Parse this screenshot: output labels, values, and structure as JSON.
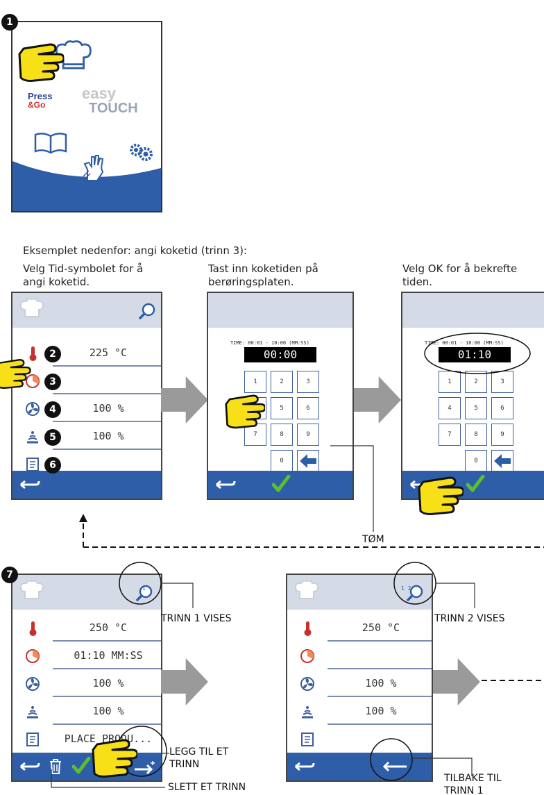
{
  "badges": [
    "1",
    "2",
    "3",
    "4",
    "5",
    "6",
    "7"
  ],
  "home_screen": {
    "press_go_line1": "Press",
    "press_go_line2": "&Go",
    "easy": "easy",
    "touch": "TOUCH"
  },
  "intro_text": "Eksemplet nedenfor: angi koketid (trinn 3):",
  "captions": {
    "step_a": "Velg Tid-symbolet for å angi koketid.",
    "step_b": "Tast inn koketiden på berøringsplaten.",
    "step_c": "Velg OK for å bekrefte tiden."
  },
  "settings_screen": {
    "rows": [
      {
        "icon": "thermometer-icon",
        "value": "225 °C"
      },
      {
        "icon": "timer-icon",
        "value": ""
      },
      {
        "icon": "fan-icon",
        "value": "100 %"
      },
      {
        "icon": "steam-icon",
        "value": "100 %"
      },
      {
        "icon": "notes-icon",
        "value": ""
      }
    ]
  },
  "keypad_screen_1": {
    "header": "TIME: 00:01 - 10:00 (MM:SS)",
    "display": "00:00"
  },
  "keypad_screen_2": {
    "header": "TIME: 00:01 - 10:00 (MM:SS)",
    "display": "01:10"
  },
  "keys": [
    "1",
    "2",
    "3",
    "4",
    "5",
    "6",
    "7",
    "8",
    "9",
    "0"
  ],
  "tom_label": "TØM",
  "step1_screen": {
    "rows": [
      {
        "icon": "thermometer-icon",
        "value": "250 °C"
      },
      {
        "icon": "timer-icon",
        "value": "01:10 MM:SS"
      },
      {
        "icon": "fan-icon",
        "value": "100 %"
      },
      {
        "icon": "steam-icon",
        "value": "100 %"
      },
      {
        "icon": "notes-icon",
        "value": "PLACE PRODU..."
      }
    ],
    "zoom_index": "1"
  },
  "step2_screen": {
    "rows": [
      {
        "icon": "thermometer-icon",
        "value": "250 °C"
      },
      {
        "icon": "timer-icon",
        "value": ""
      },
      {
        "icon": "fan-icon",
        "value": "100 %"
      },
      {
        "icon": "steam-icon",
        "value": "100 %"
      },
      {
        "icon": "notes-icon",
        "value": ""
      }
    ],
    "zoom_index": "1 2"
  },
  "callouts": {
    "trinn1": "TRINN 1 VISES",
    "trinn2": "TRINN 2 VISES",
    "legg_line1": "LEGG TIL ET",
    "legg_line2": "TRINN",
    "slett": "SLETT ET TRINN",
    "tilbake_line1": "TILBAKE TIL",
    "tilbake_line2": "TRINN 1"
  },
  "colors": {
    "header_bg": "#d4dbe6",
    "footer_bg": "#2e5ea7",
    "check_green": "#5cc02a",
    "hand_yellow": "#f7e017",
    "arrow_gray": "#9a9a9a"
  }
}
